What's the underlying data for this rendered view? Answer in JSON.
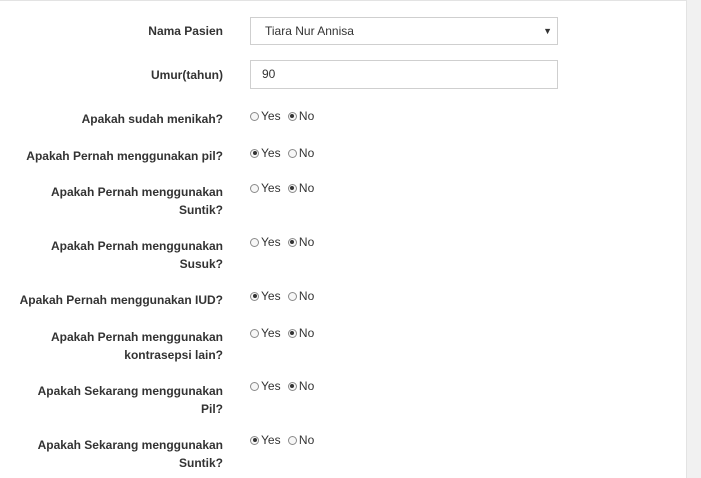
{
  "patient": {
    "label": "Nama Pasien",
    "value": "Tiara Nur Annisa"
  },
  "age": {
    "label": "Umur(tahun)",
    "value": "90"
  },
  "options": {
    "yes": "Yes",
    "no": "No"
  },
  "questions": [
    {
      "line1": "Apakah sudah menikah?",
      "line2": "",
      "selected": "No"
    },
    {
      "line1": "Apakah Pernah menggunakan pil?",
      "line2": "",
      "selected": "Yes"
    },
    {
      "line1": "Apakah Pernah menggunakan",
      "line2": "Suntik?",
      "selected": "No"
    },
    {
      "line1": "Apakah Pernah menggunakan",
      "line2": "Susuk?",
      "selected": "No"
    },
    {
      "line1": "Apakah Pernah menggunakan IUD?",
      "line2": "",
      "selected": "Yes"
    },
    {
      "line1": "Apakah Pernah menggunakan",
      "line2": "kontrasepsi lain?",
      "selected": "No"
    },
    {
      "line1": "Apakah Sekarang menggunakan",
      "line2": "Pil?",
      "selected": "No"
    },
    {
      "line1": "Apakah Sekarang menggunakan",
      "line2": "Suntik?",
      "selected": "Yes"
    }
  ]
}
